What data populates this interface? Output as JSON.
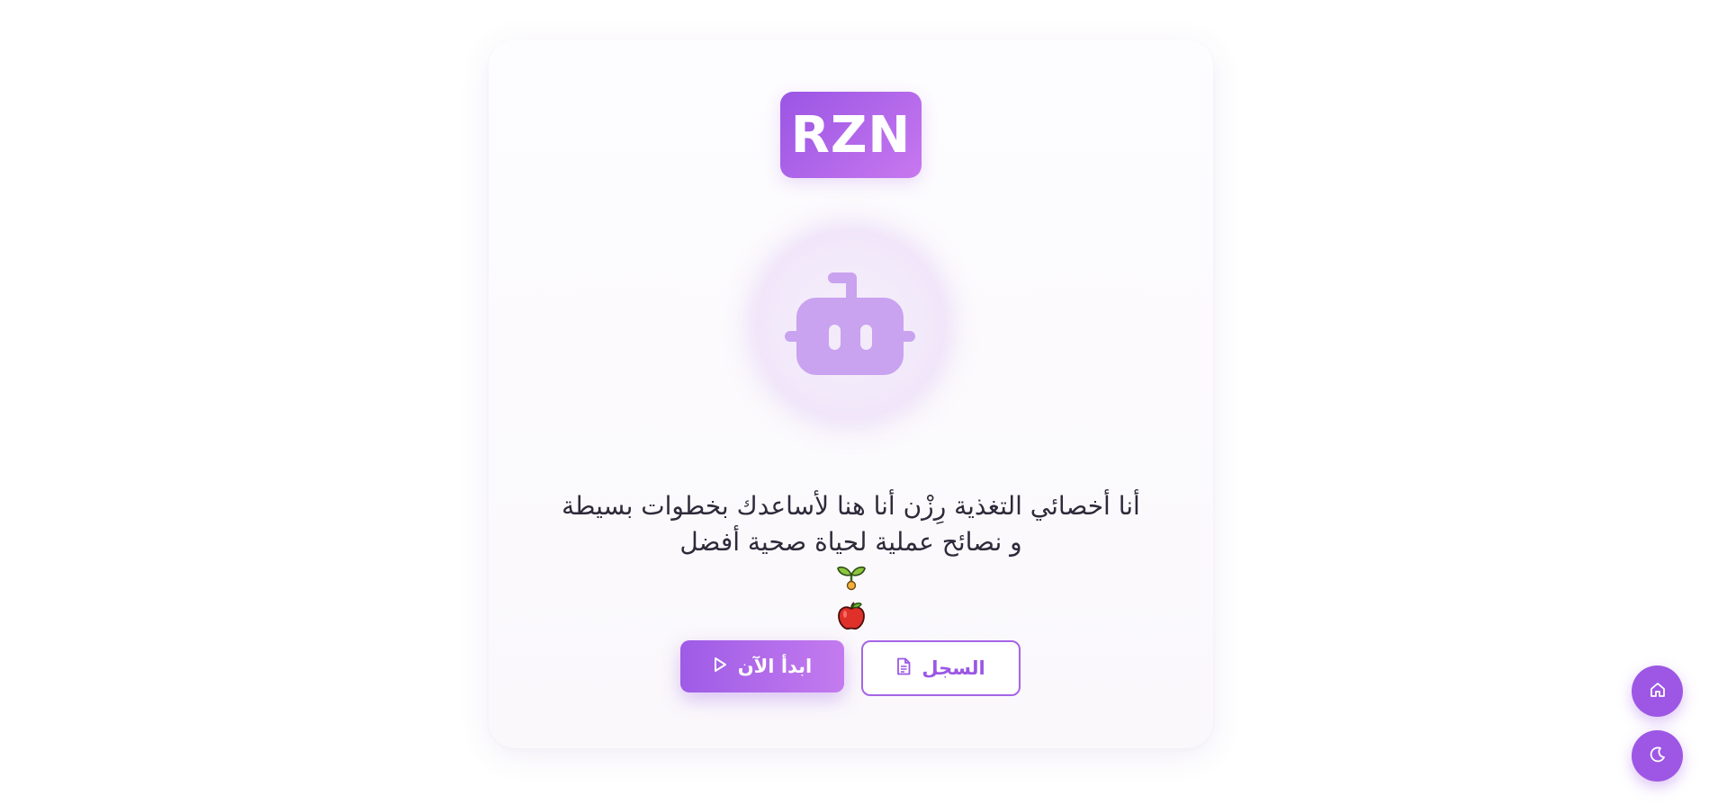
{
  "brand": {
    "logo_text": "RZN",
    "accent_color": "#9d57e4",
    "accent_light": "#c878ef"
  },
  "assistant": {
    "avatar_icon": "robot-icon",
    "message_line1": "أنا أخصائي التغذية رِزْن أنا هنا لأساعدك بخطوات بسيطة",
    "message_line2": "و نصائح عملية لحياة صحية أفضل",
    "message_emojis": [
      "seedling-icon",
      "apple-icon"
    ]
  },
  "actions": {
    "start_label": "ابدأ الآن",
    "start_icon": "play-icon",
    "history_label": "السجل",
    "history_icon": "document-icon"
  },
  "floating": {
    "home_icon": "home-icon",
    "theme_icon": "moon-icon"
  }
}
